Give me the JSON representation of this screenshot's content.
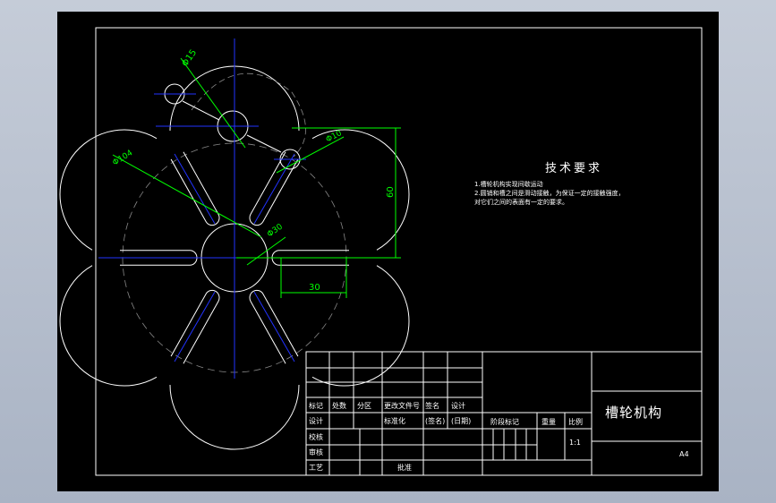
{
  "tech_requirements": {
    "heading": "技术要求",
    "line1": "1.槽轮机构实现间歇运动",
    "line2": "2.圆销和槽之间是滑动接触，为保证一定的接触强度，",
    "line3": "对它们之间的表面有一定的要求。"
  },
  "dimensions": {
    "phi15": "Φ15",
    "phi10": "Φ10",
    "phi104": "Φ104",
    "phi30": "Φ30",
    "d60": "60",
    "d30": "30"
  },
  "title_block": {
    "drawing_title": "槽轮机构",
    "sheet_size": "A4",
    "scale": "1:1",
    "headers": {
      "mark": "标记",
      "count": "处数",
      "zone": "分区",
      "change_doc": "更改文件号",
      "signature": "签名",
      "date_ymd": "年月日",
      "design": "设计",
      "standardize": "标准化",
      "sign_paren": "(签名)",
      "date_paren": "(日期)",
      "check": "校核",
      "review": "审核",
      "process": "工艺",
      "approve": "批准",
      "stage_mark": "阶段标记",
      "weight": "重量",
      "ratio": "比例"
    }
  },
  "colors": {
    "outline": "#ffffff",
    "centerline": "#2233ff",
    "dimension": "#00ff00",
    "hidden": "#888888"
  }
}
